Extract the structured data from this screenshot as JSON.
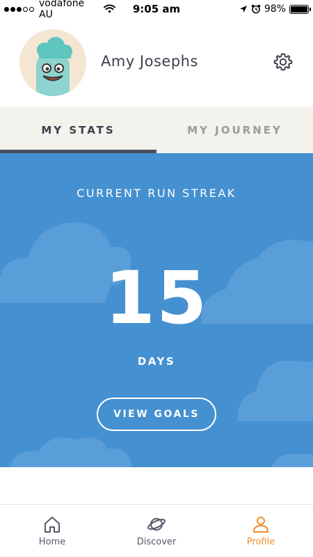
{
  "status_bar": {
    "carrier": "vodafone AU",
    "time": "9:05 am",
    "battery": "98%",
    "battery_level": 0.98,
    "signal_bars_filled": 3,
    "signal_bars_total": 5
  },
  "profile": {
    "name": "Amy Josephs",
    "avatar_icon": "cartoon-character-avatar",
    "settings_icon": "gear-icon"
  },
  "tabs": [
    {
      "label": "MY STATS",
      "active": true
    },
    {
      "label": "MY JOURNEY",
      "active": false
    }
  ],
  "streak": {
    "title": "CURRENT RUN STREAK",
    "value": "15",
    "unit": "DAYS",
    "button_label": "VIEW GOALS"
  },
  "bottom_nav": [
    {
      "label": "Home",
      "icon": "home-icon",
      "active": false
    },
    {
      "label": "Discover",
      "icon": "planet-icon",
      "active": false
    },
    {
      "label": "Profile",
      "icon": "person-icon",
      "active": true
    }
  ],
  "colors": {
    "streak_background": "#4590d0",
    "active_nav": "#ee8d2f",
    "tab_bar": "#f3f2ed",
    "tab_indicator": "#4b4e5e",
    "text_dark": "#3d3f4a"
  }
}
